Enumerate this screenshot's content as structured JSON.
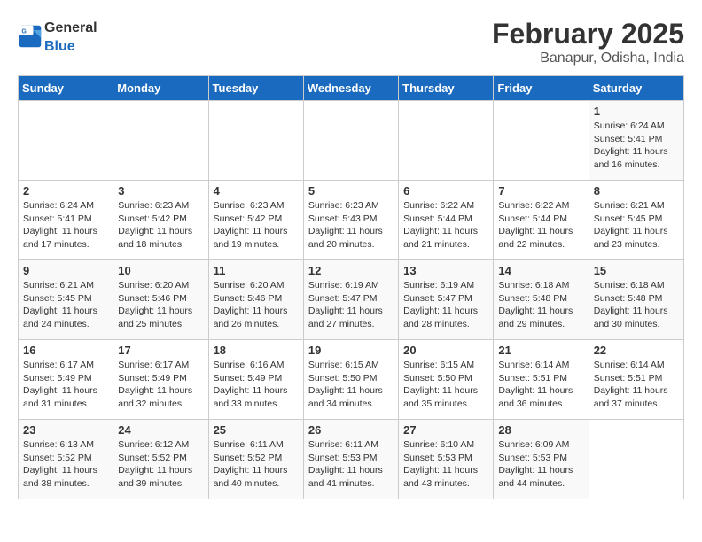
{
  "header": {
    "logo_general": "General",
    "logo_blue": "Blue",
    "month": "February 2025",
    "location": "Banapur, Odisha, India"
  },
  "days_of_week": [
    "Sunday",
    "Monday",
    "Tuesday",
    "Wednesday",
    "Thursday",
    "Friday",
    "Saturday"
  ],
  "weeks": [
    [
      {
        "day": "",
        "info": ""
      },
      {
        "day": "",
        "info": ""
      },
      {
        "day": "",
        "info": ""
      },
      {
        "day": "",
        "info": ""
      },
      {
        "day": "",
        "info": ""
      },
      {
        "day": "",
        "info": ""
      },
      {
        "day": "1",
        "info": "Sunrise: 6:24 AM\nSunset: 5:41 PM\nDaylight: 11 hours\nand 16 minutes."
      }
    ],
    [
      {
        "day": "2",
        "info": "Sunrise: 6:24 AM\nSunset: 5:41 PM\nDaylight: 11 hours\nand 17 minutes."
      },
      {
        "day": "3",
        "info": "Sunrise: 6:23 AM\nSunset: 5:42 PM\nDaylight: 11 hours\nand 18 minutes."
      },
      {
        "day": "4",
        "info": "Sunrise: 6:23 AM\nSunset: 5:42 PM\nDaylight: 11 hours\nand 19 minutes."
      },
      {
        "day": "5",
        "info": "Sunrise: 6:23 AM\nSunset: 5:43 PM\nDaylight: 11 hours\nand 20 minutes."
      },
      {
        "day": "6",
        "info": "Sunrise: 6:22 AM\nSunset: 5:44 PM\nDaylight: 11 hours\nand 21 minutes."
      },
      {
        "day": "7",
        "info": "Sunrise: 6:22 AM\nSunset: 5:44 PM\nDaylight: 11 hours\nand 22 minutes."
      },
      {
        "day": "8",
        "info": "Sunrise: 6:21 AM\nSunset: 5:45 PM\nDaylight: 11 hours\nand 23 minutes."
      }
    ],
    [
      {
        "day": "9",
        "info": "Sunrise: 6:21 AM\nSunset: 5:45 PM\nDaylight: 11 hours\nand 24 minutes."
      },
      {
        "day": "10",
        "info": "Sunrise: 6:20 AM\nSunset: 5:46 PM\nDaylight: 11 hours\nand 25 minutes."
      },
      {
        "day": "11",
        "info": "Sunrise: 6:20 AM\nSunset: 5:46 PM\nDaylight: 11 hours\nand 26 minutes."
      },
      {
        "day": "12",
        "info": "Sunrise: 6:19 AM\nSunset: 5:47 PM\nDaylight: 11 hours\nand 27 minutes."
      },
      {
        "day": "13",
        "info": "Sunrise: 6:19 AM\nSunset: 5:47 PM\nDaylight: 11 hours\nand 28 minutes."
      },
      {
        "day": "14",
        "info": "Sunrise: 6:18 AM\nSunset: 5:48 PM\nDaylight: 11 hours\nand 29 minutes."
      },
      {
        "day": "15",
        "info": "Sunrise: 6:18 AM\nSunset: 5:48 PM\nDaylight: 11 hours\nand 30 minutes."
      }
    ],
    [
      {
        "day": "16",
        "info": "Sunrise: 6:17 AM\nSunset: 5:49 PM\nDaylight: 11 hours\nand 31 minutes."
      },
      {
        "day": "17",
        "info": "Sunrise: 6:17 AM\nSunset: 5:49 PM\nDaylight: 11 hours\nand 32 minutes."
      },
      {
        "day": "18",
        "info": "Sunrise: 6:16 AM\nSunset: 5:49 PM\nDaylight: 11 hours\nand 33 minutes."
      },
      {
        "day": "19",
        "info": "Sunrise: 6:15 AM\nSunset: 5:50 PM\nDaylight: 11 hours\nand 34 minutes."
      },
      {
        "day": "20",
        "info": "Sunrise: 6:15 AM\nSunset: 5:50 PM\nDaylight: 11 hours\nand 35 minutes."
      },
      {
        "day": "21",
        "info": "Sunrise: 6:14 AM\nSunset: 5:51 PM\nDaylight: 11 hours\nand 36 minutes."
      },
      {
        "day": "22",
        "info": "Sunrise: 6:14 AM\nSunset: 5:51 PM\nDaylight: 11 hours\nand 37 minutes."
      }
    ],
    [
      {
        "day": "23",
        "info": "Sunrise: 6:13 AM\nSunset: 5:52 PM\nDaylight: 11 hours\nand 38 minutes."
      },
      {
        "day": "24",
        "info": "Sunrise: 6:12 AM\nSunset: 5:52 PM\nDaylight: 11 hours\nand 39 minutes."
      },
      {
        "day": "25",
        "info": "Sunrise: 6:11 AM\nSunset: 5:52 PM\nDaylight: 11 hours\nand 40 minutes."
      },
      {
        "day": "26",
        "info": "Sunrise: 6:11 AM\nSunset: 5:53 PM\nDaylight: 11 hours\nand 41 minutes."
      },
      {
        "day": "27",
        "info": "Sunrise: 6:10 AM\nSunset: 5:53 PM\nDaylight: 11 hours\nand 43 minutes."
      },
      {
        "day": "28",
        "info": "Sunrise: 6:09 AM\nSunset: 5:53 PM\nDaylight: 11 hours\nand 44 minutes."
      },
      {
        "day": "",
        "info": ""
      }
    ]
  ]
}
